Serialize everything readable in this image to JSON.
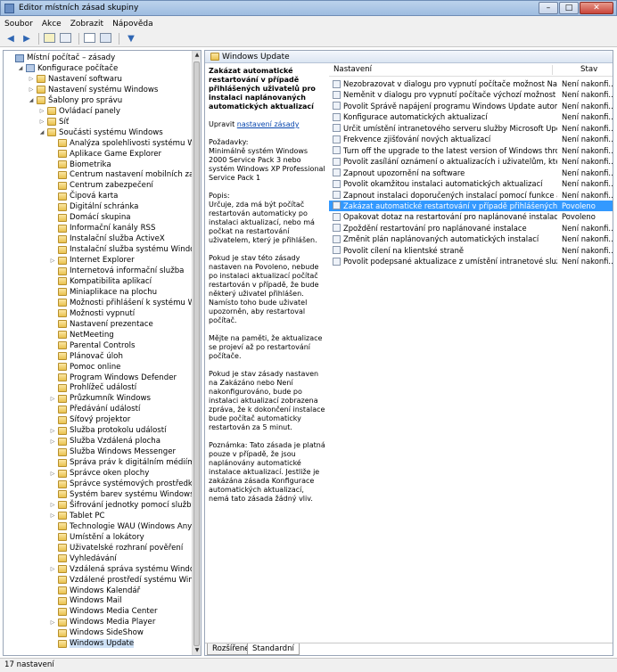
{
  "window": {
    "title": "Editor místních zásad skupiny"
  },
  "menu": [
    "Soubor",
    "Akce",
    "Zobrazit",
    "Nápověda"
  ],
  "tree": [
    {
      "label": "Místní počítač – zásady",
      "level": 0,
      "icon": "pc",
      "exp": ""
    },
    {
      "label": "Konfigurace počítače",
      "level": 1,
      "icon": "cfg",
      "exp": "open"
    },
    {
      "label": "Nastavení softwaru",
      "level": 2,
      "icon": "folder",
      "exp": "closed"
    },
    {
      "label": "Nastavení systému Windows",
      "level": 2,
      "icon": "folder",
      "exp": "closed"
    },
    {
      "label": "Šablony pro správu",
      "level": 2,
      "icon": "folder",
      "exp": "open"
    },
    {
      "label": "Ovládací panely",
      "level": 3,
      "icon": "folder",
      "exp": "closed"
    },
    {
      "label": "Síť",
      "level": 3,
      "icon": "folder",
      "exp": "closed"
    },
    {
      "label": "Součásti systému Windows",
      "level": 3,
      "icon": "folder",
      "exp": "open"
    },
    {
      "label": "Analýza spolehlivosti systému Windows",
      "level": 4,
      "icon": "folder",
      "exp": ""
    },
    {
      "label": "Aplikace Game Explorer",
      "level": 4,
      "icon": "folder",
      "exp": ""
    },
    {
      "label": "Biometrika",
      "level": 4,
      "icon": "folder",
      "exp": ""
    },
    {
      "label": "Centrum nastavení mobilních zařízení",
      "level": 4,
      "icon": "folder",
      "exp": ""
    },
    {
      "label": "Centrum zabezpečení",
      "level": 4,
      "icon": "folder",
      "exp": ""
    },
    {
      "label": "Čipová karta",
      "level": 4,
      "icon": "folder",
      "exp": ""
    },
    {
      "label": "Digitální schránka",
      "level": 4,
      "icon": "folder",
      "exp": ""
    },
    {
      "label": "Domácí skupina",
      "level": 4,
      "icon": "folder",
      "exp": ""
    },
    {
      "label": "Informační kanály RSS",
      "level": 4,
      "icon": "folder",
      "exp": ""
    },
    {
      "label": "Instalační služba ActiveX",
      "level": 4,
      "icon": "folder",
      "exp": ""
    },
    {
      "label": "Instalační služba systému Windows",
      "level": 4,
      "icon": "folder",
      "exp": ""
    },
    {
      "label": "Internet Explorer",
      "level": 4,
      "icon": "folder",
      "exp": "closed"
    },
    {
      "label": "Internetová informační služba",
      "level": 4,
      "icon": "folder",
      "exp": ""
    },
    {
      "label": "Kompatibilita aplikací",
      "level": 4,
      "icon": "folder",
      "exp": ""
    },
    {
      "label": "Miniaplikace na plochu",
      "level": 4,
      "icon": "folder",
      "exp": ""
    },
    {
      "label": "Možnosti přihlášení k systému Windows",
      "level": 4,
      "icon": "folder",
      "exp": ""
    },
    {
      "label": "Možnosti vypnutí",
      "level": 4,
      "icon": "folder",
      "exp": ""
    },
    {
      "label": "Nastavení prezentace",
      "level": 4,
      "icon": "folder",
      "exp": ""
    },
    {
      "label": "NetMeeting",
      "level": 4,
      "icon": "folder",
      "exp": ""
    },
    {
      "label": "Parental Controls",
      "level": 4,
      "icon": "folder",
      "exp": ""
    },
    {
      "label": "Plánovač úloh",
      "level": 4,
      "icon": "folder",
      "exp": ""
    },
    {
      "label": "Pomoc online",
      "level": 4,
      "icon": "folder",
      "exp": ""
    },
    {
      "label": "Program Windows Defender",
      "level": 4,
      "icon": "folder",
      "exp": ""
    },
    {
      "label": "Prohlížeč událostí",
      "level": 4,
      "icon": "folder",
      "exp": ""
    },
    {
      "label": "Průzkumník Windows",
      "level": 4,
      "icon": "folder",
      "exp": "closed"
    },
    {
      "label": "Předávání událostí",
      "level": 4,
      "icon": "folder",
      "exp": ""
    },
    {
      "label": "Síťový projektor",
      "level": 4,
      "icon": "folder",
      "exp": ""
    },
    {
      "label": "Služba protokolu událostí",
      "level": 4,
      "icon": "folder",
      "exp": "closed"
    },
    {
      "label": "Služba Vzdálená plocha",
      "level": 4,
      "icon": "folder",
      "exp": "closed"
    },
    {
      "label": "Služba Windows Messenger",
      "level": 4,
      "icon": "folder",
      "exp": ""
    },
    {
      "label": "Správa práv k digitálním médiím služby W",
      "level": 4,
      "icon": "folder",
      "exp": ""
    },
    {
      "label": "Správce oken plochy",
      "level": 4,
      "icon": "folder",
      "exp": "closed"
    },
    {
      "label": "Správce systémových prostředků",
      "level": 4,
      "icon": "folder",
      "exp": ""
    },
    {
      "label": "Systém barev systému Windows",
      "level": 4,
      "icon": "folder",
      "exp": ""
    },
    {
      "label": "Šifrování jednotky pomocí služby BitLock",
      "level": 4,
      "icon": "folder",
      "exp": "closed"
    },
    {
      "label": "Tablet PC",
      "level": 4,
      "icon": "folder",
      "exp": "closed"
    },
    {
      "label": "Technologie WAU (Windows Anytime Up",
      "level": 4,
      "icon": "folder",
      "exp": ""
    },
    {
      "label": "Umístění a lokátory",
      "level": 4,
      "icon": "folder",
      "exp": ""
    },
    {
      "label": "Uživatelské rozhraní pověření",
      "level": 4,
      "icon": "folder",
      "exp": ""
    },
    {
      "label": "Vyhledávání",
      "level": 4,
      "icon": "folder",
      "exp": ""
    },
    {
      "label": "Vzdálená správa systému Windows",
      "level": 4,
      "icon": "folder",
      "exp": "closed"
    },
    {
      "label": "Vzdálené prostředí systému Windows",
      "level": 4,
      "icon": "folder",
      "exp": ""
    },
    {
      "label": "Windows Kalendář",
      "level": 4,
      "icon": "folder",
      "exp": ""
    },
    {
      "label": "Windows Mail",
      "level": 4,
      "icon": "folder",
      "exp": ""
    },
    {
      "label": "Windows Media Center",
      "level": 4,
      "icon": "folder",
      "exp": ""
    },
    {
      "label": "Windows Media Player",
      "level": 4,
      "icon": "folder",
      "exp": "closed"
    },
    {
      "label": "Windows SideShow",
      "level": 4,
      "icon": "folder",
      "exp": ""
    },
    {
      "label": "Windows Update",
      "level": 4,
      "icon": "folder",
      "exp": "",
      "selected": true
    }
  ],
  "right_header": "Windows Update",
  "description": {
    "title": "Zakázat automatické restartování v případě přihlášených uživatelů pro instalaci naplánovaných automatických aktualizací",
    "edit_prefix": "Upravit ",
    "edit_link": "nastavení zásady",
    "req_label": "Požadavky:",
    "req_text": "Minimálně systém Windows 2000 Service Pack 3 nebo systém Windows XP Professional Service Pack 1",
    "popis_label": "Popis:",
    "p1": "Určuje, zda má být počítač restartován automaticky po instalaci aktualizací, nebo má počkat na restartování uživatelem, který je přihlášen.",
    "p2": "Pokud je stav této zásady nastaven na Povoleno, nebude po instalaci aktualizací počítač restartován v případě, že bude některý uživatel přihlášen. Namísto toho bude uživatel upozorněn, aby restartoval počítač.",
    "p3": "Mějte na paměti, že aktualizace se projeví až po restartování počítače.",
    "p4": "Pokud je stav zásady nastaven na Zakázáno nebo Není nakonfigurováno, bude po instalaci aktualizací zobrazena zpráva, že k dokončení instalace bude počítač automaticky restartován za 5 minut.",
    "p5": "Poznámka: Tato zásada je platná pouze v případě, že jsou naplánovány automatické instalace aktualizací. Jestliže je zakázána zásada Konfigurace automatických aktualizací, nemá tato zásada žádný vliv."
  },
  "columns": {
    "name": "Nastavení",
    "state": "Stav"
  },
  "policies": [
    {
      "name": "Nezobrazovat v dialogu pro vypnutí počítače možnost Nainstalovat...",
      "state": "Není nakonfi..."
    },
    {
      "name": "Neměnit v dialogu pro vypnutí počítače výchozí možnost na Nains...",
      "state": "Není nakonfi..."
    },
    {
      "name": "Povolit Správě napájení programu Windows Update automaticky p...",
      "state": "Není nakonfi..."
    },
    {
      "name": "Konfigurace automatických aktualizací",
      "state": "Není nakonfi..."
    },
    {
      "name": "Určit umístění intranetového serveru služby Microsoft Update",
      "state": "Není nakonfi..."
    },
    {
      "name": "Frekvence zjišťování nových aktualizací",
      "state": "Není nakonfi..."
    },
    {
      "name": "Turn off the upgrade to the latest version of Windows through Win...",
      "state": "Není nakonfi..."
    },
    {
      "name": "Povolit zasílání oznámení o aktualizacích i uživatelům, kteří nejsou ...",
      "state": "Není nakonfi..."
    },
    {
      "name": "Zapnout upozornění na software",
      "state": "Není nakonfi..."
    },
    {
      "name": "Povolit okamžitou instalaci automatických aktualizací",
      "state": "Není nakonfi..."
    },
    {
      "name": "Zapnout instalaci doporučených instalací pomocí funkce automati...",
      "state": "Není nakonfi..."
    },
    {
      "name": "Zakázat automatické restartování v případě přihlášených uživatelů ...",
      "state": "Povoleno",
      "selected": true
    },
    {
      "name": "Opakovat dotaz na restartování pro naplánované instalace",
      "state": "Povoleno"
    },
    {
      "name": "Zpoždění restartování pro naplánované instalace",
      "state": "Není nakonfi..."
    },
    {
      "name": "Změnit plán naplánovaných automatických instalací",
      "state": "Není nakonfi..."
    },
    {
      "name": "Povolit cílení na klientské straně",
      "state": "Není nakonfi..."
    },
    {
      "name": "Povolit podepsané aktualizace z umístění intranetové služby Micros...",
      "state": "Není nakonfi..."
    }
  ],
  "tabs": [
    "Rozšířené",
    "Standardní"
  ],
  "status": "17 nastavení",
  "colors": {
    "selection": "#3399ff",
    "link": "#0645ad"
  }
}
